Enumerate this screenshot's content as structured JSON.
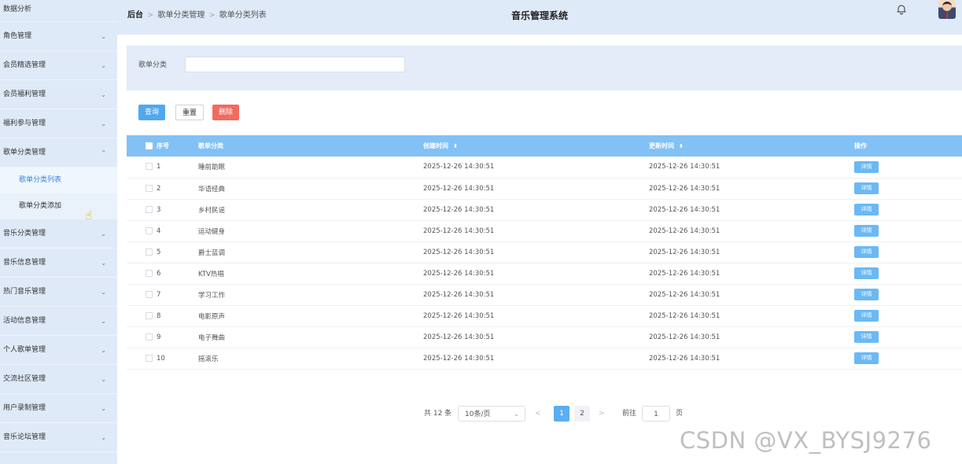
{
  "sidebar": {
    "top_label": "数据分析",
    "items": [
      {
        "label": "角色管理",
        "chevron": "chevron-down"
      },
      {
        "label": "会员精选管理",
        "chevron": "chevron-down"
      },
      {
        "label": "会员福利管理",
        "chevron": "chevron-down"
      },
      {
        "label": "福利参与管理",
        "chevron": "chevron-down"
      },
      {
        "label": "歌单分类管理",
        "chevron": "chevron-up",
        "expanded": true
      }
    ],
    "sub_items": [
      {
        "label": "歌单分类列表",
        "active": true
      },
      {
        "label": "歌单分类添加",
        "active": false
      }
    ],
    "items_after": [
      {
        "label": "音乐分类管理",
        "chevron": "chevron-down"
      },
      {
        "label": "音乐信息管理",
        "chevron": "chevron-down"
      },
      {
        "label": "热门音乐管理",
        "chevron": "chevron-down"
      },
      {
        "label": "活动信息管理",
        "chevron": "chevron-down"
      },
      {
        "label": "个人歌单管理",
        "chevron": "chevron-down"
      },
      {
        "label": "交流社区管理",
        "chevron": "chevron-down"
      },
      {
        "label": "用户录制管理",
        "chevron": "chevron-down"
      },
      {
        "label": "音乐论坛管理",
        "chevron": "chevron-down"
      }
    ],
    "chevron_down_glyph": "⌄",
    "chevron_up_glyph": "⌃"
  },
  "header": {
    "breadcrumb": [
      "后台",
      "歌单分类管理",
      "歌单分类列表"
    ],
    "separator": ">",
    "title": "音乐管理系统",
    "icons": [
      "bell-icon",
      "avatar"
    ]
  },
  "search": {
    "label": "歌单分类",
    "value": "",
    "placeholder": ""
  },
  "toolbar": {
    "query_label": "查询",
    "reset_label": "重置",
    "delete_label": "删除"
  },
  "table": {
    "columns": {
      "index": "序号",
      "name": "歌单分类",
      "created": "创建时间",
      "updated": "更新时间",
      "action": "操作"
    },
    "sort_glyph": "⬍",
    "detail_label": "详情",
    "rows": [
      {
        "index": "1",
        "name": "睡前助眠",
        "created": "2025-12-26 14:30:51",
        "updated": "2025-12-26 14:30:51"
      },
      {
        "index": "2",
        "name": "华语经典",
        "created": "2025-12-26 14:30:51",
        "updated": "2025-12-26 14:30:51"
      },
      {
        "index": "3",
        "name": "乡村民谣",
        "created": "2025-12-26 14:30:51",
        "updated": "2025-12-26 14:30:51"
      },
      {
        "index": "4",
        "name": "运动健身",
        "created": "2025-12-26 14:30:51",
        "updated": "2025-12-26 14:30:51"
      },
      {
        "index": "5",
        "name": "爵士蓝调",
        "created": "2025-12-26 14:30:51",
        "updated": "2025-12-26 14:30:51"
      },
      {
        "index": "6",
        "name": "KTV热唱",
        "created": "2025-12-26 14:30:51",
        "updated": "2025-12-26 14:30:51"
      },
      {
        "index": "7",
        "name": "学习工作",
        "created": "2025-12-26 14:30:51",
        "updated": "2025-12-26 14:30:51"
      },
      {
        "index": "8",
        "name": "电影原声",
        "created": "2025-12-26 14:30:51",
        "updated": "2025-12-26 14:30:51"
      },
      {
        "index": "9",
        "name": "电子舞曲",
        "created": "2025-12-26 14:30:51",
        "updated": "2025-12-26 14:30:51"
      },
      {
        "index": "10",
        "name": "摇滚乐",
        "created": "2025-12-26 14:30:51",
        "updated": "2025-12-26 14:30:51"
      }
    ]
  },
  "pagination": {
    "total_text": "共 12 条",
    "page_size": "10条/页",
    "pages": [
      "1",
      "2"
    ],
    "current_page": "1",
    "prev_glyph": "<",
    "next_glyph": ">",
    "goto_label": "前往",
    "goto_value": "1",
    "page_unit": "页"
  },
  "watermark": "CSDN @VX_BYSJ9276",
  "colors": {
    "sidebar_bg": "#dfeaf8",
    "table_header": "#82c1f5",
    "primary": "#4fa8f0",
    "danger": "#f36a5f"
  }
}
